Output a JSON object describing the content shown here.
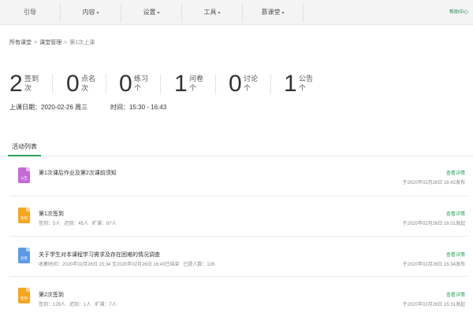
{
  "nav": {
    "items": [
      {
        "label": "引导",
        "caret": ""
      },
      {
        "label": "内容",
        "caret": "▾"
      },
      {
        "label": "设置",
        "caret": "▾"
      },
      {
        "label": "工具",
        "caret": "▾"
      },
      {
        "label": "慕课堂",
        "caret": "▾"
      }
    ],
    "help": "帮助中心"
  },
  "breadcrumb": {
    "root": "所有课堂",
    "manage": "课堂管理",
    "current": "第1次上课",
    "separator": ">"
  },
  "stats": [
    {
      "value": "2",
      "label": "签到",
      "unit": "次"
    },
    {
      "value": "0",
      "label": "点名",
      "unit": "次"
    },
    {
      "value": "0",
      "label": "练习",
      "unit": "个"
    },
    {
      "value": "1",
      "label": "问卷",
      "unit": "个"
    },
    {
      "value": "0",
      "label": "讨论",
      "unit": "个"
    },
    {
      "value": "1",
      "label": "公告",
      "unit": "个"
    }
  ],
  "class_info": {
    "date_label": "上课日期：",
    "date_value": "2020-02-26 周三",
    "time_label": "时间：",
    "time_value": "15:30 - 16:43"
  },
  "tabs": {
    "activity": "活动列表"
  },
  "activities": [
    {
      "icon": "公告",
      "icon_color": "#c56ad6",
      "title": "第1次课后作业及第2次课前须知",
      "meta": [],
      "link": "查看详情",
      "time": "于2020年02月26日 16:42发布"
    },
    {
      "icon": "签到",
      "icon_color": "#f5a623",
      "title": "第1次签到",
      "meta": [
        "签到：5人",
        "迟到：45人",
        "旷课：87人"
      ],
      "link": "查看详情",
      "time": "于2020年02月26日 16:01发起"
    },
    {
      "icon": "问卷",
      "icon_color": "#5b9be6",
      "title": "关于学生对本课程学习需求及存在困难的情况调查",
      "meta": [
        "收集时间：2020年02月26日 15:34 至2020年02月26日 16:43已结束",
        "已提人数：126"
      ],
      "link": "查看详情",
      "time": "于2020年02月26日 15:34发布"
    },
    {
      "icon": "签到",
      "icon_color": "#f5a623",
      "title": "第2次签到",
      "meta": [
        "签到：129人",
        "迟到：1人",
        "旷课：7人"
      ],
      "link": "查看详情",
      "time": "于2020年02月26日 15:31发起"
    }
  ]
}
